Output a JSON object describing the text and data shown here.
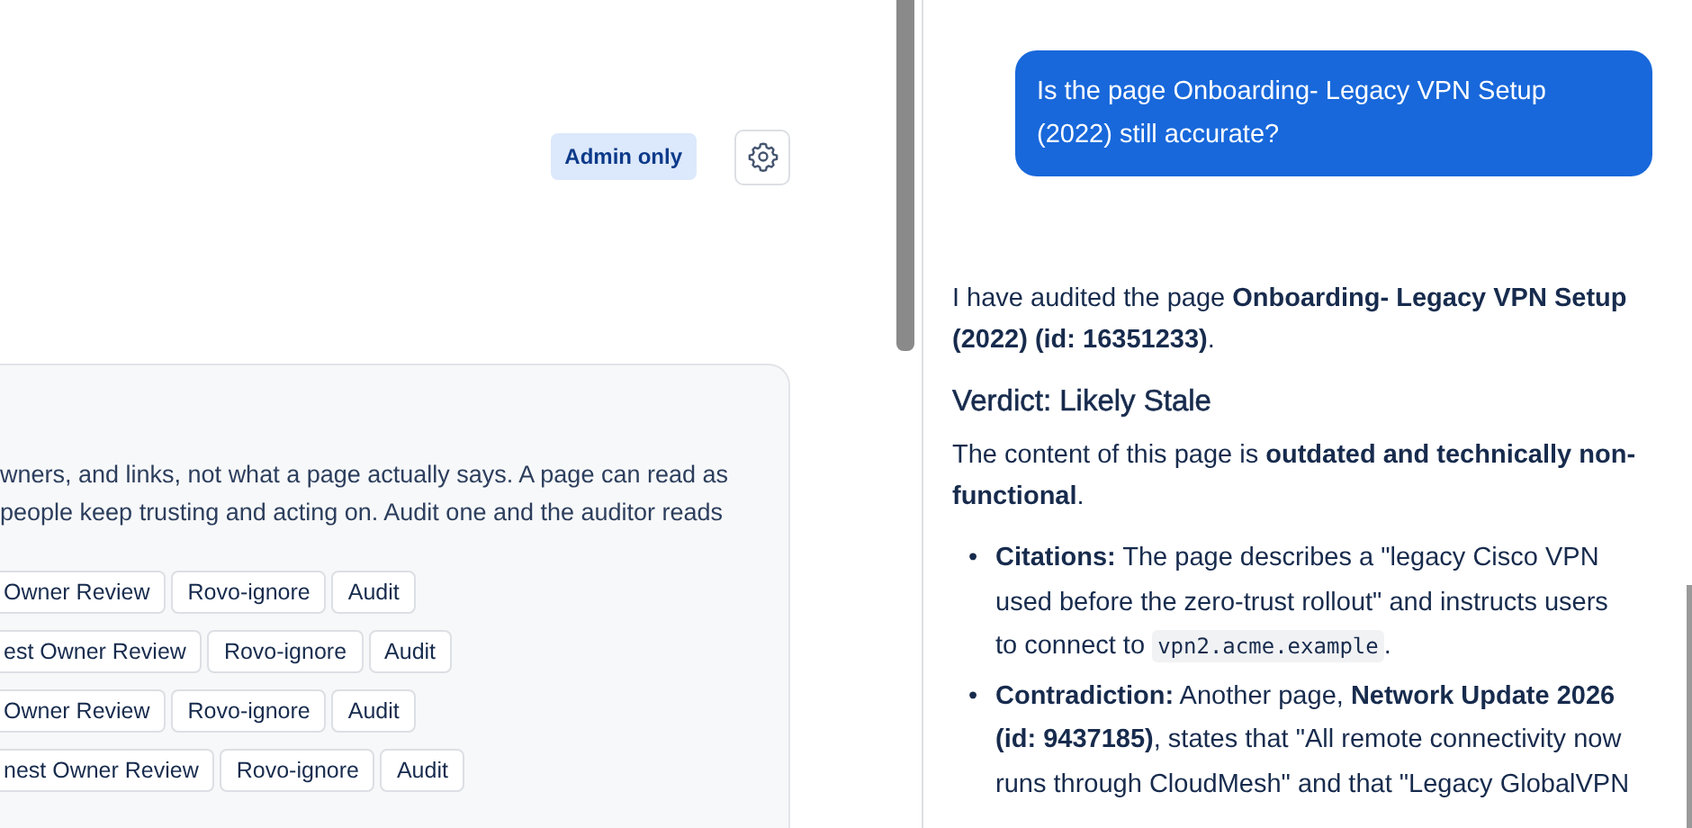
{
  "left_panel": {
    "badge": "Admin only",
    "card": {
      "lines": [
        "wners, and links, not what a page actually says. A page can read as",
        "people keep trusting and acting on. Audit one and the auditor reads"
      ],
      "rows": [
        {
          "buttons": [
            "Owner Review",
            "Rovo-ignore",
            "Audit"
          ]
        },
        {
          "buttons": [
            "est Owner Review",
            "Rovo-ignore",
            "Audit"
          ]
        },
        {
          "buttons": [
            "Owner Review",
            "Rovo-ignore",
            "Audit"
          ]
        },
        {
          "buttons": [
            "nest Owner Review",
            "Rovo-ignore",
            "Audit"
          ]
        }
      ]
    }
  },
  "chat": {
    "user_message": "Is the page Onboarding- Legacy VPN Setup (2022) still accurate?",
    "reply": {
      "intro": "I have audited the page **Onboarding- Legacy VPN Setup (2022) (id: 16351233)**.",
      "heading": "Verdict: Likely Stale",
      "summary": "The content of this page is **outdated and technically non-functional**.",
      "bullets": [
        {
          "marker": "•",
          "parts": [
            {
              "kind": "text",
              "text": "**Citations:** The page describes a \"legacy Cisco VPN used before the zero-trust rollout\" and instructs users to connect to "
            },
            {
              "kind": "code",
              "text": "vpn2.acme.example"
            },
            {
              "kind": "text",
              "text": "."
            }
          ]
        },
        {
          "marker": "•",
          "parts": [
            {
              "kind": "text",
              "text": "**Contradiction:** Another page, **Network Update 2026 (id: 9437185)**, states that \"All remote connectivity now runs through CloudMesh\" and that \"Legacy GlobalVPN"
            }
          ]
        }
      ]
    }
  }
}
